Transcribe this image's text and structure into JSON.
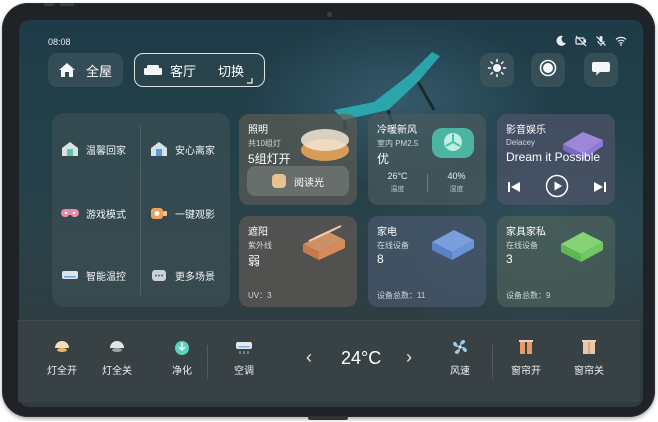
{
  "status": {
    "time": "08:08",
    "icons": [
      "moon-icon",
      "camera-off-icon",
      "mic-off-icon",
      "wifi-icon"
    ]
  },
  "header": {
    "home_label": "全屋",
    "room_label": "客厅",
    "switch_label": "切换"
  },
  "scenes": {
    "items": [
      {
        "label": "温馨回家",
        "icon": "home-warm-icon"
      },
      {
        "label": "安心离家",
        "icon": "home-leave-icon"
      },
      {
        "label": "游戏模式",
        "icon": "gamepad-icon"
      },
      {
        "label": "一键观影",
        "icon": "movie-icon"
      },
      {
        "label": "智能温控",
        "icon": "ac-icon"
      },
      {
        "label": "更多场景",
        "icon": "more-scenes-icon"
      }
    ]
  },
  "cards": {
    "lighting": {
      "title": "照明",
      "sub": "共10组灯",
      "value": "5组灯开",
      "button": "阅读光"
    },
    "climate": {
      "title": "冷暖新风",
      "sub": "室内 PM2.5",
      "value": "优",
      "temp_value": "26°C",
      "temp_label": "温度",
      "hum_value": "40%",
      "hum_label": "湿度"
    },
    "media": {
      "title": "影音娱乐",
      "sub": "Delacey",
      "value": "Dream it Possible"
    },
    "shade": {
      "title": "遮阳",
      "sub": "紫外线",
      "value": "弱",
      "foot": "UV：3"
    },
    "appliance": {
      "title": "家电",
      "sub": "在线设备",
      "value": "8",
      "foot": "设备总数：11"
    },
    "furniture": {
      "title": "家具家私",
      "sub": "在线设备",
      "value": "3",
      "foot": "设备总数：9"
    }
  },
  "bottom": {
    "lights_on": "灯全开",
    "lights_off": "灯全关",
    "purify": "净化",
    "ac": "空调",
    "temperature": "24°C",
    "fan_speed": "风速",
    "curtain_open": "窗帘开",
    "curtain_close": "窗帘关"
  },
  "colors": {
    "accent_teal": "#3fbfae",
    "warm_orange": "#f0a25a",
    "screen_bg": "#22404a"
  }
}
